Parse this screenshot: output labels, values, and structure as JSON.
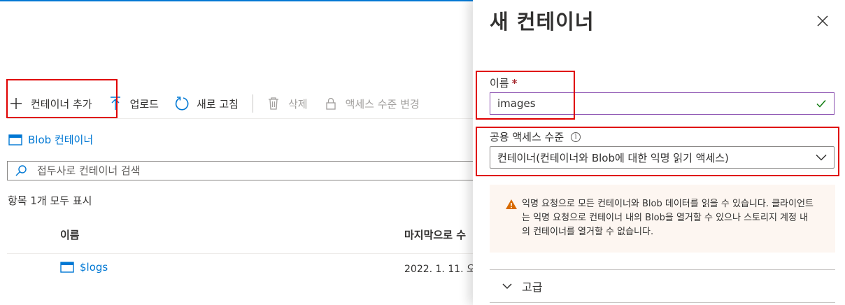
{
  "toolbar": {
    "add_container": "컨테이너 추가",
    "upload": "업로드",
    "refresh": "새로 고침",
    "delete": "삭제",
    "change_access": "액세스 수준 변경"
  },
  "breadcrumb": {
    "label": "Blob 컨테이너"
  },
  "search": {
    "placeholder": "접두사로 컨테이너 검색"
  },
  "list": {
    "count_text": "항목 1개 모두 표시",
    "columns": {
      "name": "이름",
      "modified": "마지막으로 수"
    },
    "rows": [
      {
        "name": "$logs",
        "modified": "2022. 1. 11. 오"
      }
    ]
  },
  "panel": {
    "title": "새 컨테이너",
    "name_label": "이름",
    "required_mark": "*",
    "name_value": "images",
    "access_label": "공용 액세스 수준",
    "info_glyph": "i",
    "access_value": "컨테이너(컨테이너와 Blob에 대한 익명 읽기 액세스)",
    "warning": "익명 요청으로 모든 컨테이너와 Blob 데이터를 읽을 수 있습니다. 클라이언트는 익명 요청으로 컨테이너 내의 Blob을 열거할 수 있으나 스토리지 계정 내의 컨테이너를 열거할 수 없습니다.",
    "advanced": "고급"
  },
  "colors": {
    "accent": "#0078d4",
    "highlight_box": "#e00000",
    "warning_icon": "#d86a00",
    "valid_check": "#107c10"
  }
}
